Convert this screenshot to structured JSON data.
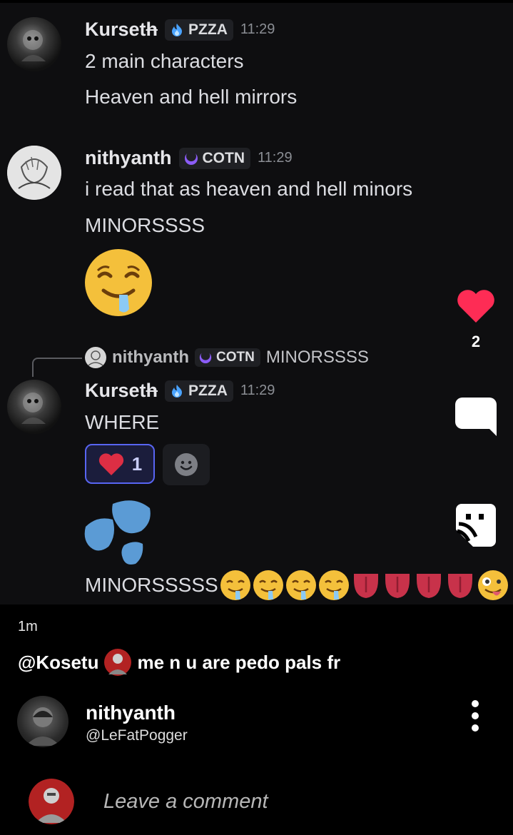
{
  "post_image": {
    "messages": [
      {
        "username_prefix": "Kurset",
        "username_struck": "h",
        "tag": "PZZA",
        "time": "11:29",
        "lines": [
          "2 main characters",
          "Heaven and hell mirrors"
        ]
      },
      {
        "username": "nithyanth",
        "tag": "COTN",
        "time": "11:29",
        "lines": [
          "i read that as heaven and hell minors",
          "MINORSSSS"
        ]
      }
    ],
    "reply_preview": {
      "username": "nithyanth",
      "tag": "COTN",
      "text": "MINORSSSS"
    },
    "reply_message": {
      "username_prefix": "Kurset",
      "username_struck": "h",
      "tag": "PZZA",
      "time": "11:29",
      "text": "WHERE",
      "reaction_count": "1",
      "last_line": "MINORSSSSS"
    }
  },
  "actions": {
    "like_count": "2"
  },
  "post": {
    "time_ago": "1m",
    "mention": "@Kosetu",
    "caption": "me n u are pedo pals fr"
  },
  "author": {
    "name": "nithyanth",
    "handle": "@LeFatPogger"
  },
  "comment": {
    "placeholder": "Leave a comment"
  },
  "colors": {
    "like": "#fe2c55",
    "reaction_border": "#5865f2"
  }
}
